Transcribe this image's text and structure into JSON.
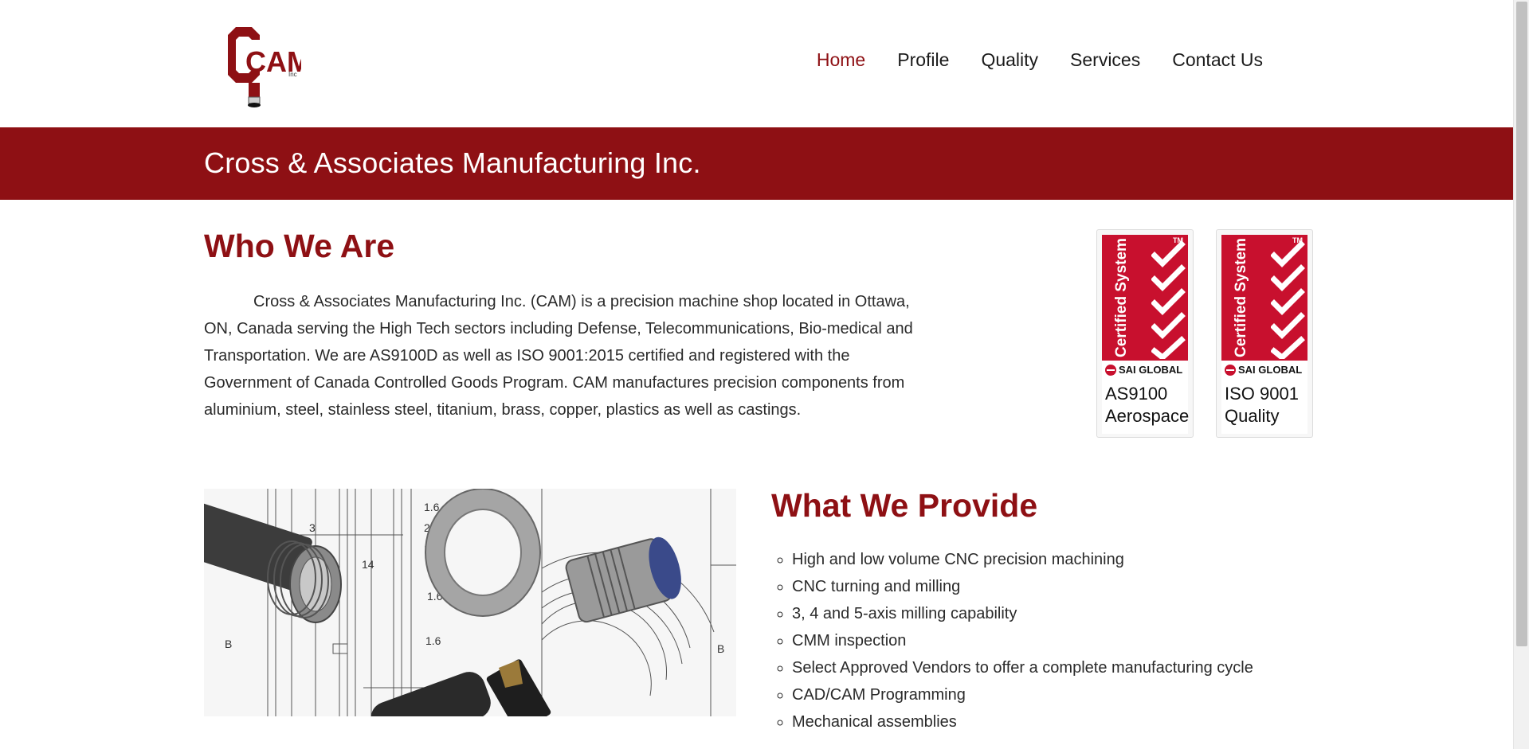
{
  "header": {
    "logo_text": "CAM",
    "logo_sub": "Inc",
    "nav": [
      {
        "label": "Home",
        "active": true
      },
      {
        "label": "Profile",
        "active": false
      },
      {
        "label": "Quality",
        "active": false
      },
      {
        "label": "Services",
        "active": false
      },
      {
        "label": "Contact Us",
        "active": false
      }
    ]
  },
  "banner": {
    "title": "Cross & Associates Manufacturing Inc."
  },
  "who": {
    "heading": "Who We Are",
    "paragraph": "Cross & Associates Manufacturing Inc. (CAM) is a precision machine shop located in Ottawa, ON, Canada serving the High Tech sectors including Defense, Telecommunications, Bio-medical and Transportation. We are AS9100D as well as ISO 9001:2015 certified and registered with the Government of Canada Controlled Goods Program. CAM manufactures precision components from aluminium, steel, stainless steel, titanium, brass, copper, plastics as well as castings."
  },
  "badges": [
    {
      "cert_text": "Certified System",
      "tm": "TM",
      "brand": "SAI GLOBAL",
      "line1": "AS9100",
      "line2": "Aerospace"
    },
    {
      "cert_text": "Certified System",
      "tm": "TM",
      "brand": "SAI GLOBAL",
      "line1": "ISO 9001",
      "line2": "Quality"
    }
  ],
  "provide": {
    "heading": "What We Provide",
    "items": [
      "High and low volume CNC precision machining",
      "CNC turning and milling",
      "3, 4 and 5-axis milling capability",
      "CMM inspection",
      "Select Approved Vendors to offer a complete manufacturing cycle",
      "CAD/CAM Programming",
      "Mechanical assemblies"
    ]
  },
  "image": {
    "drawing_labels": [
      "3",
      "14",
      "1.6",
      "2.",
      "1.",
      "1.6",
      "1.6",
      "B",
      "B"
    ]
  },
  "colors": {
    "brand_red": "#8e1014",
    "badge_red": "#c8102e"
  }
}
